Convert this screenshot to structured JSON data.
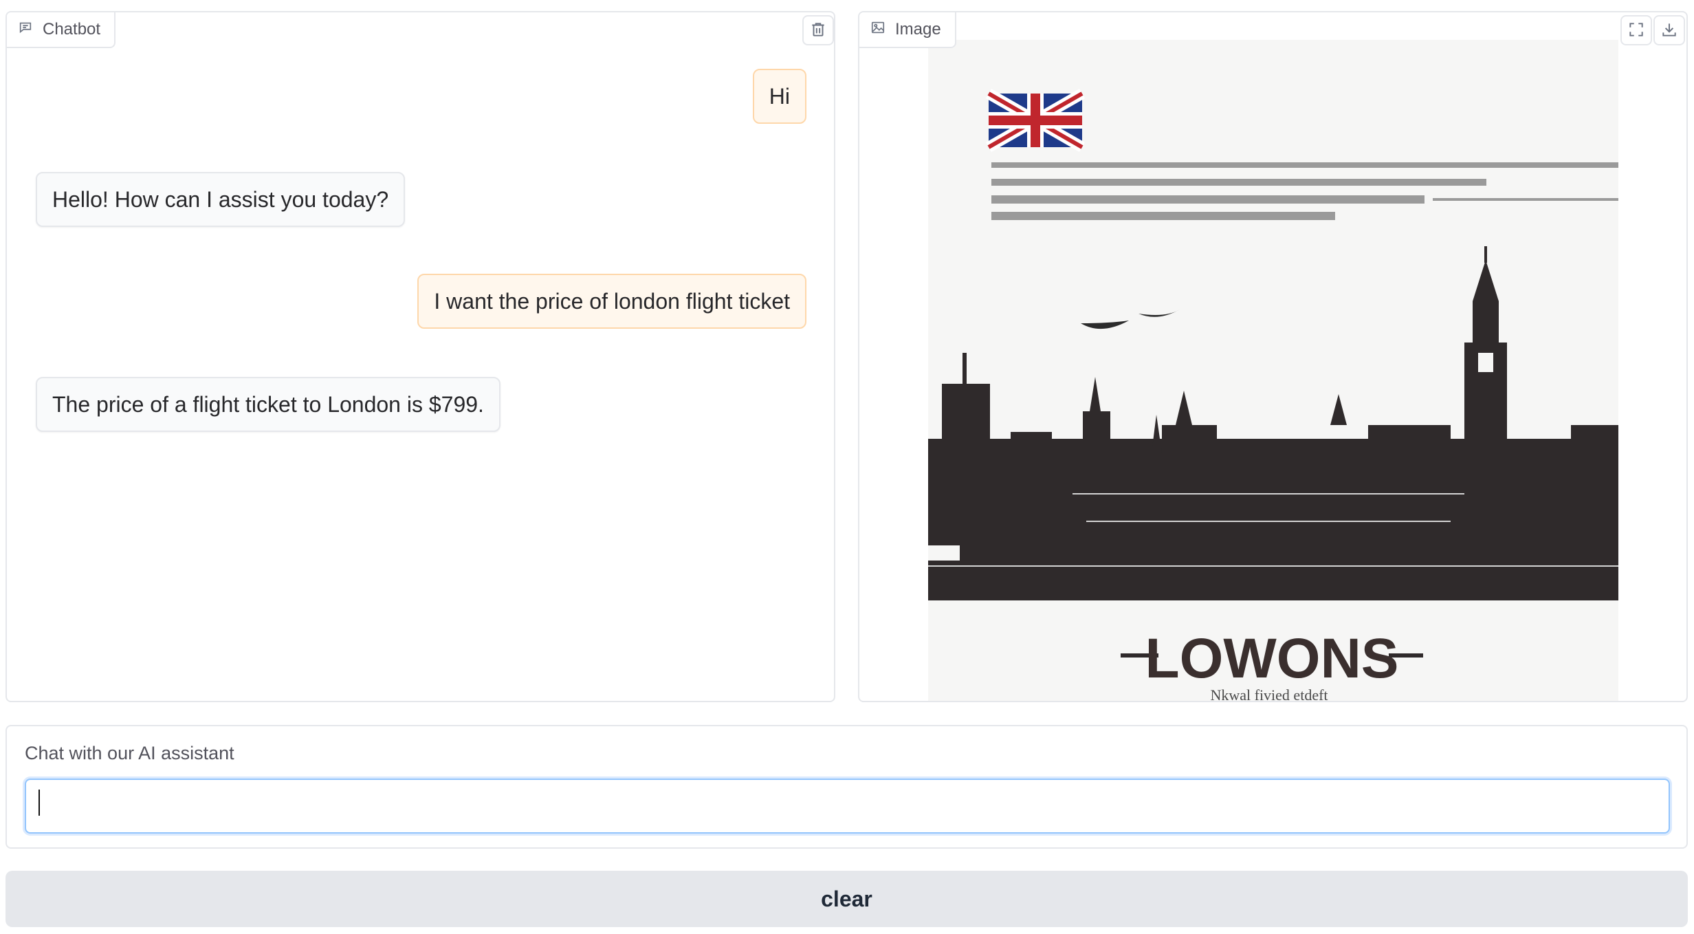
{
  "chatbot": {
    "label": "Chatbot",
    "messages": [
      {
        "role": "user",
        "text": "Hi"
      },
      {
        "role": "bot",
        "text": "Hello! How can I assist you today?"
      },
      {
        "role": "user",
        "text": "I want the price of london flight ticket"
      },
      {
        "role": "bot",
        "text": "The price of a flight ticket to London is $799."
      }
    ]
  },
  "image_panel": {
    "label": "Image",
    "poster_title": "LOWONS",
    "poster_subtitle": "Nkwal fivied etdeft"
  },
  "input": {
    "label": "Chat with our AI assistant",
    "value": "",
    "placeholder": ""
  },
  "clear_button": {
    "label": "clear"
  },
  "colors": {
    "user_bubble_bg": "#fff7ed",
    "user_bubble_border": "#fed7aa",
    "bot_bubble_bg": "#f9fafb",
    "focus_ring": "#93c5fd",
    "button_bg": "#e5e7eb"
  },
  "icons": {
    "chatbot": "chat-icon",
    "trash": "trash-icon",
    "image": "image-icon",
    "fullscreen": "fullscreen-icon",
    "download": "download-icon"
  }
}
